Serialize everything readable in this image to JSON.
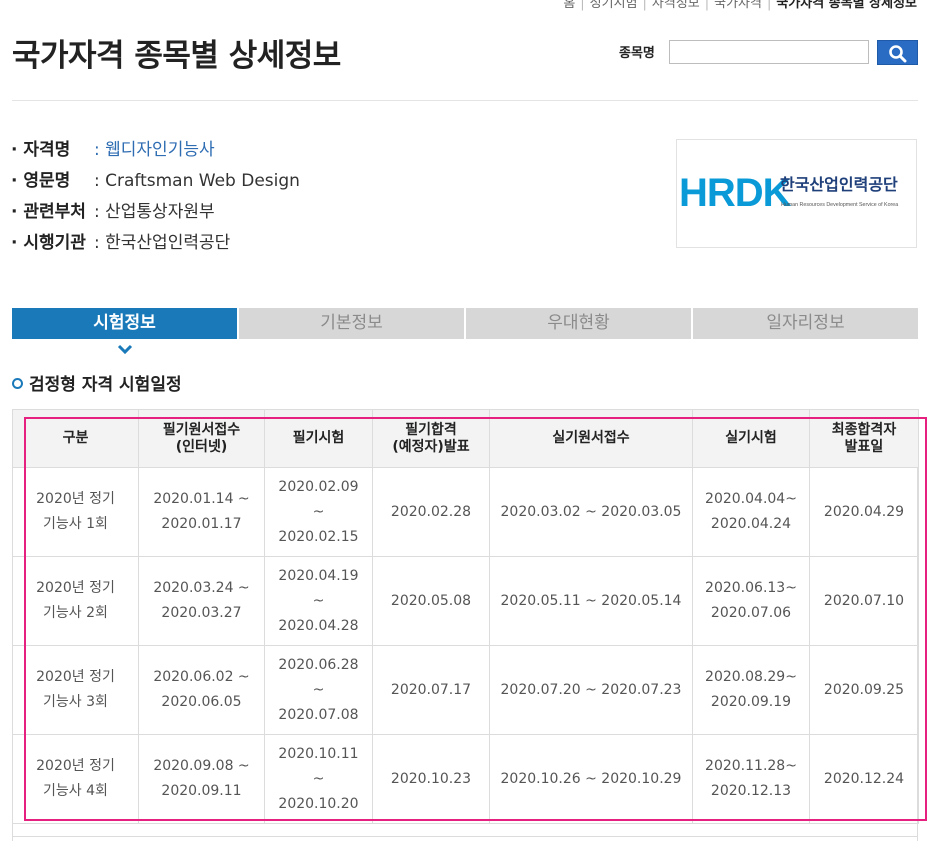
{
  "breadcrumb": [
    "홈",
    "정기시험",
    "자격정보",
    "국가자격",
    "국가자격 종목별 상세정보"
  ],
  "page_title": "국가자격 종목별 상세정보",
  "search": {
    "label": "종목명",
    "value": "",
    "placeholder": ""
  },
  "info": [
    {
      "label": "자격명",
      "value": ": 웹디자인기능사"
    },
    {
      "label": "영문명",
      "value": ": Craftsman Web Design"
    },
    {
      "label": "관련부처",
      "value": ": 산업통상자원부"
    },
    {
      "label": "시행기관",
      "value": ": 한국산업인력공단"
    }
  ],
  "logo": {
    "mark": "HRDK",
    "name_ko": "한국산업인력공단",
    "name_en": "Human Resources Development Service of Korea",
    "accent": "#0a9ad8",
    "dark": "#1e3f7a"
  },
  "tabs": [
    "시험정보",
    "기본정보",
    "우대현황",
    "일자리정보"
  ],
  "section_title": "검정형 자격 시험일정",
  "table": {
    "headers": [
      [
        "구분"
      ],
      [
        "필기원서접수",
        "(인터넷)"
      ],
      [
        "필기시험"
      ],
      [
        "필기합격",
        "(예정자)발표"
      ],
      [
        "실기원서접수"
      ],
      [
        "실기시험"
      ],
      [
        "최종합격자",
        "발표일"
      ]
    ],
    "rows": [
      [
        [
          "2020년 정기",
          "기능사 1회"
        ],
        [
          "2020.01.14 ~",
          "2020.01.17"
        ],
        [
          "2020.02.09",
          "~",
          "2020.02.15"
        ],
        [
          "2020.02.28"
        ],
        [
          "2020.03.02 ~ 2020.03.05"
        ],
        [
          "2020.04.04~",
          "2020.04.24"
        ],
        [
          "2020.04.29"
        ]
      ],
      [
        [
          "2020년 정기",
          "기능사 2회"
        ],
        [
          "2020.03.24 ~",
          "2020.03.27"
        ],
        [
          "2020.04.19",
          "~",
          "2020.04.28"
        ],
        [
          "2020.05.08"
        ],
        [
          "2020.05.11 ~ 2020.05.14"
        ],
        [
          "2020.06.13~",
          "2020.07.06"
        ],
        [
          "2020.07.10"
        ]
      ],
      [
        [
          "2020년 정기",
          "기능사 3회"
        ],
        [
          "2020.06.02 ~",
          "2020.06.05"
        ],
        [
          "2020.06.28",
          "~",
          "2020.07.08"
        ],
        [
          "2020.07.17"
        ],
        [
          "2020.07.20 ~ 2020.07.23"
        ],
        [
          "2020.08.29~",
          "2020.09.19"
        ],
        [
          "2020.09.25"
        ]
      ],
      [
        [
          "2020년 정기",
          "기능사 4회"
        ],
        [
          "2020.09.08 ~",
          "2020.09.11"
        ],
        [
          "2020.10.11",
          "~",
          "2020.10.20"
        ],
        [
          "2020.10.23"
        ],
        [
          "2020.10.26 ~ 2020.10.29"
        ],
        [
          "2020.11.28~",
          "2020.12.13"
        ],
        [
          "2020.12.24"
        ]
      ]
    ]
  },
  "colors": {
    "tab_active": "#1a79b9",
    "tab_inactive": "#d7d7d7",
    "search_button": "#2a6cc4",
    "link": "#2f6db3",
    "highlight": "#e5207e"
  }
}
